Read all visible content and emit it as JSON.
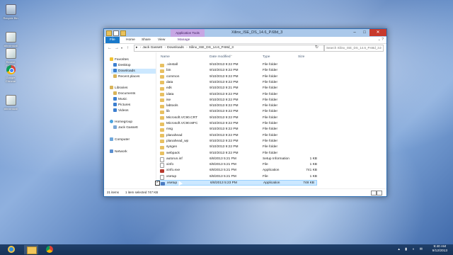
{
  "desktop": {
    "icons": [
      {
        "label": "Recycle Bin",
        "icon": "recycle-bin-icon"
      },
      {
        "label": "xilinxinstall",
        "icon": "file-icon"
      },
      {
        "label": "Recent Folders",
        "icon": "folder-icon"
      },
      {
        "label": "Google Chrome",
        "icon": "chrome-icon"
      },
      {
        "label": "xilinxinstall",
        "icon": "file-icon"
      }
    ]
  },
  "window": {
    "title": "Xilinx_ISE_DS_14.6_P.68d_3",
    "context_tab": "Application Tools",
    "ribbon_tabs": [
      "File",
      "Home",
      "Share",
      "View",
      "Manage"
    ],
    "address": {
      "parts": [
        "Jack Gassett",
        "Downloads",
        "Xilinx_ISE_DS_14.6_P.68d_3"
      ],
      "arrow": "›"
    },
    "search_placeholder": "Search Xilinx_ISE_DS_14.6_P.68d_3",
    "nav": {
      "favorites": "Favorites",
      "desktop": "Desktop",
      "downloads": "Downloads",
      "recent": "Recent places",
      "libraries": "Libraries",
      "documents": "Documents",
      "music": "Music",
      "pictures": "Pictures",
      "videos": "Videos",
      "homegroup": "Homegroup",
      "user": "Jack Gassett",
      "computer": "Computer",
      "network": "Network"
    },
    "columns": {
      "name": "Name",
      "date": "Date modified",
      "type": "Type",
      "size": "Size"
    },
    "files": [
      {
        "name": ".xinstall",
        "date": "9/10/2013 9:22 PM",
        "type": "File folder",
        "size": "",
        "kind": "folder"
      },
      {
        "name": "bin",
        "date": "9/10/2013 9:22 PM",
        "type": "File folder",
        "size": "",
        "kind": "folder"
      },
      {
        "name": "common",
        "date": "9/10/2013 9:22 PM",
        "type": "File folder",
        "size": "",
        "kind": "folder"
      },
      {
        "name": "data",
        "date": "9/10/2013 9:22 PM",
        "type": "File folder",
        "size": "",
        "kind": "folder"
      },
      {
        "name": "edk",
        "date": "9/10/2013 9:21 PM",
        "type": "File folder",
        "size": "",
        "kind": "folder"
      },
      {
        "name": "idata",
        "date": "9/10/2013 9:22 PM",
        "type": "File folder",
        "size": "",
        "kind": "folder"
      },
      {
        "name": "ise",
        "date": "9/10/2013 9:22 PM",
        "type": "File folder",
        "size": "",
        "kind": "folder"
      },
      {
        "name": "labtools",
        "date": "9/10/2013 9:22 PM",
        "type": "File folder",
        "size": "",
        "kind": "folder"
      },
      {
        "name": "lib",
        "date": "9/10/2013 9:22 PM",
        "type": "File folder",
        "size": "",
        "kind": "folder"
      },
      {
        "name": "Microsoft.VC90.CRT",
        "date": "9/10/2013 9:22 PM",
        "type": "File folder",
        "size": "",
        "kind": "folder"
      },
      {
        "name": "Microsoft.VC90.MFC",
        "date": "9/10/2013 9:22 PM",
        "type": "File folder",
        "size": "",
        "kind": "folder"
      },
      {
        "name": "msg",
        "date": "9/10/2013 9:22 PM",
        "type": "File folder",
        "size": "",
        "kind": "folder"
      },
      {
        "name": "planahead",
        "date": "9/10/2013 9:22 PM",
        "type": "File folder",
        "size": "",
        "kind": "folder"
      },
      {
        "name": "planahead_wp",
        "date": "9/10/2013 9:22 PM",
        "type": "File folder",
        "size": "",
        "kind": "folder"
      },
      {
        "name": "sysgen",
        "date": "9/10/2013 9:22 PM",
        "type": "File folder",
        "size": "",
        "kind": "folder"
      },
      {
        "name": "webpack",
        "date": "9/10/2013 9:22 PM",
        "type": "File folder",
        "size": "",
        "kind": "folder"
      },
      {
        "name": "autorun.inf",
        "date": "6/8/2013 5:21 PM",
        "type": "Setup Information",
        "size": "1 KB",
        "kind": "doc"
      },
      {
        "name": "xinfo",
        "date": "6/8/2013 5:21 PM",
        "type": "File",
        "size": "1 KB",
        "kind": "doc"
      },
      {
        "name": "xinfo.exe",
        "date": "6/8/2013 5:21 PM",
        "type": "Application",
        "size": "741 KB",
        "kind": "app"
      },
      {
        "name": "xsetup",
        "date": "6/8/2013 5:21 PM",
        "type": "File",
        "size": "1 KB",
        "kind": "doc"
      },
      {
        "name": "xsetup",
        "date": "6/8/2013 5:23 PM",
        "type": "Application",
        "size": "748 KB",
        "kind": "setup",
        "selected": true
      }
    ],
    "status": {
      "items": "21 items",
      "selected": "1 item selected  747 KB"
    }
  },
  "taskbar": {
    "time": "9:40 AM",
    "date": "9/12/2013"
  }
}
